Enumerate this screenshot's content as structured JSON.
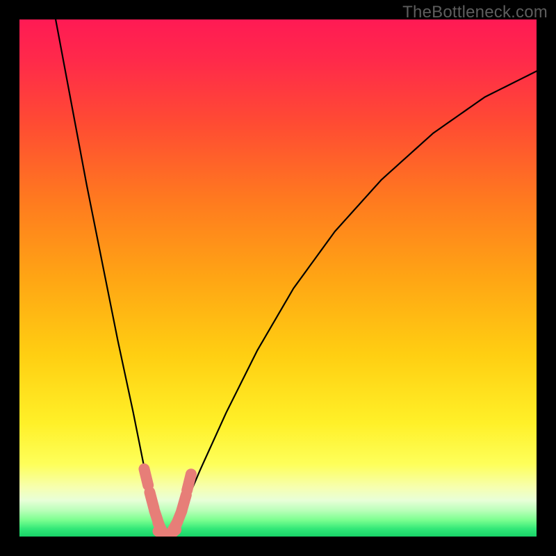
{
  "watermark": "TheBottleneck.com",
  "colors": {
    "background_black": "#000000",
    "gradient_stops": [
      {
        "offset": 0.0,
        "color": "#ff1a54"
      },
      {
        "offset": 0.08,
        "color": "#ff2a4a"
      },
      {
        "offset": 0.2,
        "color": "#ff4b33"
      },
      {
        "offset": 0.35,
        "color": "#ff7a1f"
      },
      {
        "offset": 0.5,
        "color": "#ffa514"
      },
      {
        "offset": 0.65,
        "color": "#ffcf12"
      },
      {
        "offset": 0.78,
        "color": "#fff028"
      },
      {
        "offset": 0.86,
        "color": "#feff5a"
      },
      {
        "offset": 0.905,
        "color": "#f6ffb0"
      },
      {
        "offset": 0.93,
        "color": "#e8ffd8"
      },
      {
        "offset": 0.95,
        "color": "#b8ffb8"
      },
      {
        "offset": 0.968,
        "color": "#7cff90"
      },
      {
        "offset": 0.985,
        "color": "#32e878"
      },
      {
        "offset": 1.0,
        "color": "#18d268"
      }
    ],
    "curve_black": "#000000",
    "marker_salmon": "#e77e78"
  },
  "chart_data": {
    "type": "line",
    "title": "",
    "xlabel": "",
    "ylabel": "",
    "xlim": [
      0,
      100
    ],
    "ylim": [
      0,
      100
    ],
    "grid": false,
    "series": [
      {
        "name": "bottleneck-curve",
        "x": [
          7,
          10,
          13,
          16,
          19,
          22,
          24,
          25.5,
          26.5,
          27.5,
          28.3,
          29,
          30,
          32,
          35,
          40,
          46,
          53,
          61,
          70,
          80,
          90,
          100
        ],
        "y": [
          100,
          84,
          68,
          53,
          38,
          24,
          14,
          8,
          4,
          1.5,
          0.3,
          0.6,
          2,
          6,
          13,
          24,
          36,
          48,
          59,
          69,
          78,
          85,
          90
        ]
      }
    ],
    "highlighted_points": {
      "name": "near-zero-markers",
      "color": "#e77e78",
      "x": [
        24.5,
        25.6,
        26.6,
        27.5,
        28.2,
        29.0,
        29.8,
        30.8,
        31.8,
        32.8
      ],
      "y": [
        11.5,
        7.0,
        3.5,
        1.2,
        0.2,
        0.3,
        1.5,
        3.5,
        6.5,
        10.5
      ]
    },
    "annotations": [
      {
        "text": "TheBottleneck.com",
        "position": "top-right"
      }
    ]
  }
}
